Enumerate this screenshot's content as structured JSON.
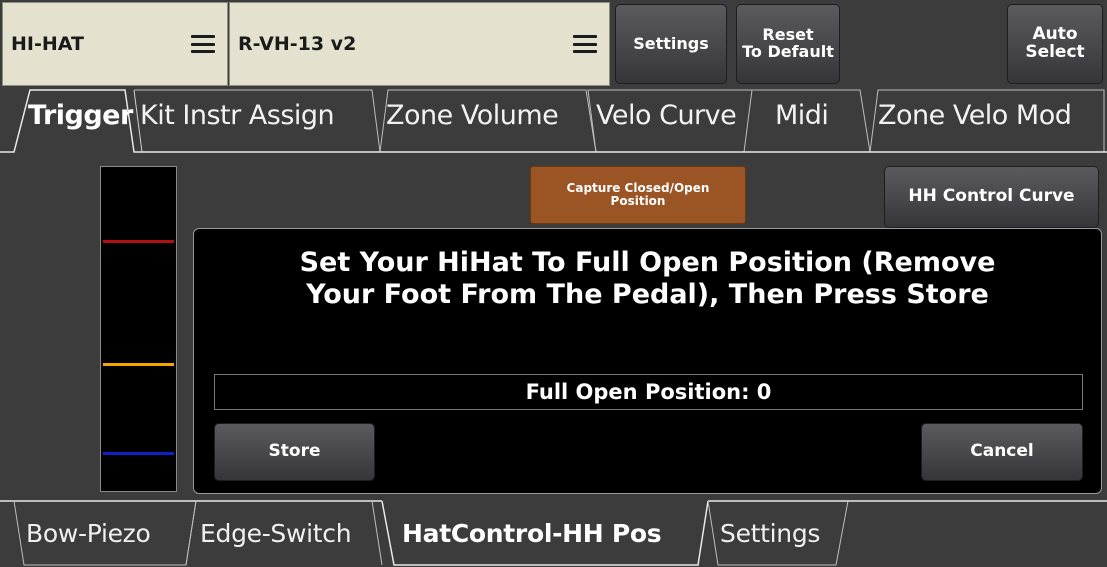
{
  "topbar": {
    "instrument_selector": "HI-HAT",
    "kit_selector": "R-VH-13 v2",
    "settings_label": "Settings",
    "reset_label": "Reset\nTo Default",
    "auto_select_label": "Auto\nSelect"
  },
  "main_tabs": [
    {
      "label": "Trigger",
      "active": true
    },
    {
      "label": "Kit Instr Assign",
      "active": false
    },
    {
      "label": "Zone Volume",
      "active": false
    },
    {
      "label": "Velo Curve",
      "active": false
    },
    {
      "label": "Midi",
      "active": false
    },
    {
      "label": "Zone Velo Mod",
      "active": false
    }
  ],
  "meter": {
    "lines": [
      {
        "color": "#b01010"
      },
      {
        "color": "#f5a400"
      },
      {
        "color": "#1020c8"
      }
    ]
  },
  "buttons": {
    "capture_label": "Capture Closed/Open\nPosition",
    "hh_curve_label": "HH Control Curve"
  },
  "dialog": {
    "message_line1": "Set Your HiHat To Full Open Position (Remove",
    "message_line2": "Your Foot From The Pedal), Then Press Store",
    "readout_label": "Full Open Position:",
    "readout_value": "0",
    "store_label": "Store",
    "cancel_label": "Cancel"
  },
  "sub_tabs": [
    {
      "label": "Bow-Piezo",
      "active": false
    },
    {
      "label": "Edge-Switch",
      "active": false
    },
    {
      "label": "HatControl-HH Pos",
      "active": true
    },
    {
      "label": "Settings",
      "active": false
    }
  ],
  "colors": {
    "selector_bg": "#e4e2cf",
    "capture_accent": "#9b5423",
    "background": "#3c3c3c"
  }
}
